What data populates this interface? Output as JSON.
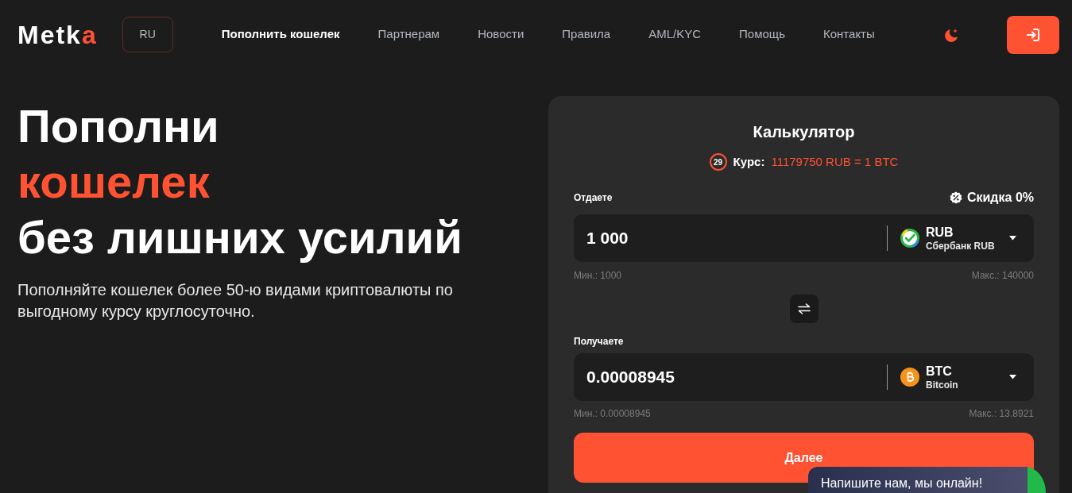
{
  "header": {
    "logo": {
      "text": "Metk",
      "accent": "a"
    },
    "language": "RU",
    "nav": [
      {
        "label": "Пополнить кошелек",
        "selected": true
      },
      {
        "label": "Партнерам",
        "selected": false
      },
      {
        "label": "Новости",
        "selected": false
      },
      {
        "label": "Правила",
        "selected": false
      },
      {
        "label": "AML/KYC",
        "selected": false
      },
      {
        "label": "Помощь",
        "selected": false
      },
      {
        "label": "Контакты",
        "selected": false
      }
    ]
  },
  "hero": {
    "title": [
      {
        "text": "Пополни",
        "highlighted": false
      },
      {
        "text": "кошелек",
        "highlighted": true
      },
      {
        "text": "без лишних усилий",
        "highlighted": false
      }
    ],
    "subtitle": "Пополняйте кошелек более 50-ю видами криптовалюты по выгодному курсу круглосуточно."
  },
  "calculator": {
    "title": "Калькулятор",
    "timer": "29",
    "rate_label": "Курс:",
    "rate_value": "11179750 RUB = 1 BTC",
    "discount": "Скидка 0%",
    "fields": [
      {
        "label": "Отдаете",
        "amount": "1 000",
        "currency": "RUB",
        "currency_name": "Сбербанк RUB",
        "kind": "bank",
        "min": "Мин.: 1000",
        "max": "Макс.: 140000"
      },
      {
        "label": "Получаете",
        "amount": "0.00008945",
        "currency": "BTC",
        "currency_name": "Bitcoin",
        "kind": "coin",
        "min": "Мин.: 0.00008945",
        "max": "Макс.: 13.8921"
      }
    ],
    "submit": "Далее"
  },
  "chat_widget": {
    "text": "Напишите нам, мы онлайн!"
  }
}
